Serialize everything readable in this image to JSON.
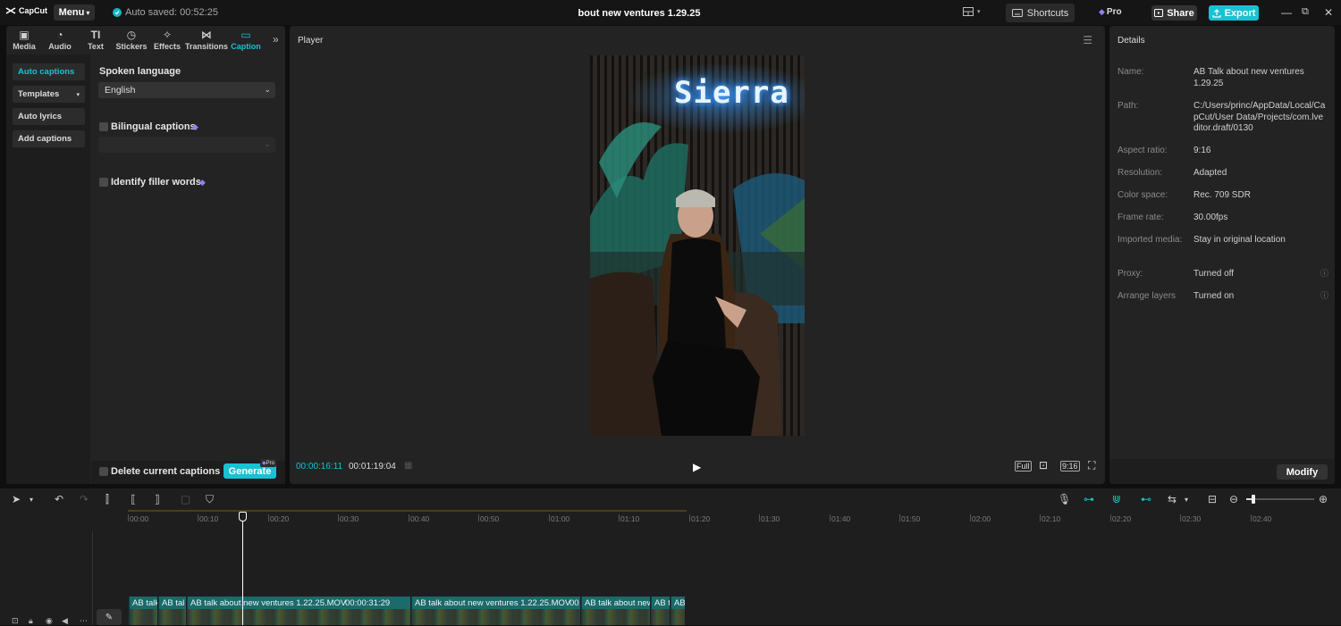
{
  "titlebar": {
    "app_name": "CapCut",
    "menu_label": "Menu",
    "autosave": "Auto saved: 00:52:25",
    "project_title": "bout new ventures 1.29.25",
    "shortcuts_label": "Shortcuts",
    "pro_label": "Pro",
    "share_label": "Share",
    "export_label": "Export"
  },
  "media_tabs": [
    {
      "label": "Media",
      "icon": "media-icon"
    },
    {
      "label": "Audio",
      "icon": "audio-icon"
    },
    {
      "label": "Text",
      "icon": "text-icon"
    },
    {
      "label": "Stickers",
      "icon": "stickers-icon"
    },
    {
      "label": "Effects",
      "icon": "effects-icon"
    },
    {
      "label": "Transitions",
      "icon": "transitions-icon"
    },
    {
      "label": "Caption",
      "icon": "caption-icon"
    }
  ],
  "caption_nav": [
    {
      "label": "Auto captions"
    },
    {
      "label": "Templates"
    },
    {
      "label": "Auto lyrics"
    },
    {
      "label": "Add captions"
    }
  ],
  "caption_panel": {
    "spoken_language_label": "Spoken language",
    "spoken_language_value": "English",
    "bilingual_label": "Bilingual captions",
    "filler_label": "Identify filler words",
    "delete_label": "Delete current captions",
    "generate_label": "Generate",
    "generate_badge": "Pro"
  },
  "player": {
    "title": "Player",
    "current_time": "00:00:16:11",
    "total_time": "00:01:19:04",
    "full_label": "Full",
    "ratio_label": "9:16",
    "video_sign": "Sierra"
  },
  "details": {
    "title": "Details",
    "rows": [
      {
        "key": "Name:",
        "value": "AB Talk about new ventures 1.29.25"
      },
      {
        "key": "Path:",
        "value": "C:/Users/princ/AppData/Local/CapCut/User Data/Projects/com.lveditor.draft/0130"
      },
      {
        "key": "Aspect ratio:",
        "value": "9:16"
      },
      {
        "key": "Resolution:",
        "value": "Adapted"
      },
      {
        "key": "Color space:",
        "value": "Rec. 709 SDR"
      },
      {
        "key": "Frame rate:",
        "value": "30.00fps"
      },
      {
        "key": "Imported media:",
        "value": "Stay in original location"
      },
      {
        "key": "Proxy:",
        "value": "Turned off"
      },
      {
        "key": "Arrange layers",
        "value": "Turned on"
      }
    ],
    "modify_label": "Modify"
  },
  "timeline": {
    "ruler": [
      "00:00",
      "00:10",
      "00:20",
      "00:30",
      "00:40",
      "00:50",
      "01:00",
      "01:10",
      "01:20",
      "01:30",
      "01:40",
      "01:50",
      "02:00",
      "02:10",
      "02:20",
      "02:30",
      "02:40"
    ],
    "clips": [
      {
        "label": "AB talk"
      },
      {
        "label": "AB tal"
      },
      {
        "label": "AB talk about new ventures 1.22.25.MOV",
        "duration": "00:00:31:29"
      },
      {
        "label": "AB talk about new ventures 1.22.25.MOV",
        "duration": "00"
      },
      {
        "label": "AB talk about new ven"
      },
      {
        "label": "AB t"
      },
      {
        "label": "AB"
      }
    ]
  },
  "colors": {
    "accent": "#17c2d2",
    "background": "#0f0f0f",
    "panel": "#232323"
  }
}
